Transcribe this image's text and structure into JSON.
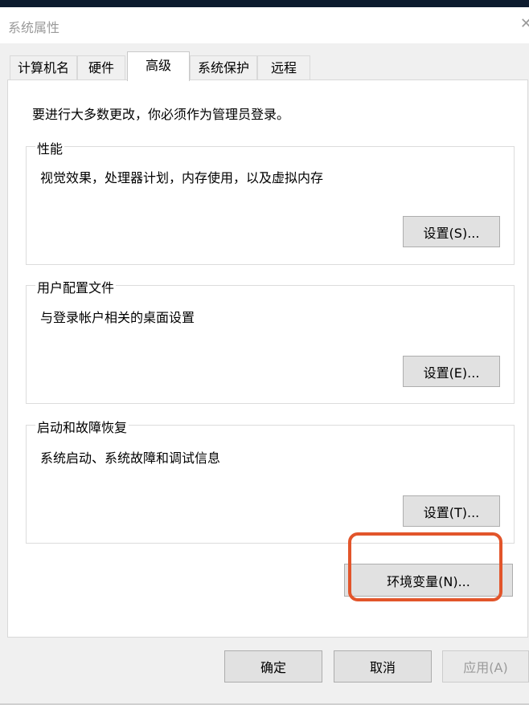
{
  "window": {
    "title": "系统属性",
    "close_icon": "close-icon"
  },
  "tabs": [
    {
      "label": "计算机名"
    },
    {
      "label": "硬件"
    },
    {
      "label": "高级"
    },
    {
      "label": "系统保护"
    },
    {
      "label": "远程"
    }
  ],
  "active_tab": "高级",
  "notice": "要进行大多数更改，你必须作为管理员登录。",
  "groups": {
    "performance": {
      "title": "性能",
      "description": "视觉效果，处理器计划，内存使用，以及虚拟内存",
      "button": "设置(S)..."
    },
    "user_profiles": {
      "title": "用户配置文件",
      "description": "与登录帐户相关的桌面设置",
      "button": "设置(E)..."
    },
    "startup_recovery": {
      "title": "启动和故障恢复",
      "description": "系统启动、系统故障和调试信息",
      "button": "设置(T)..."
    }
  },
  "env_button": "环境变量(N)...",
  "footer": {
    "ok": "确定",
    "cancel": "取消",
    "apply": "应用(A)"
  },
  "colors": {
    "highlight": "#e2552b",
    "window_bg": "#f0f0f0",
    "panel_bg": "#ffffff"
  }
}
